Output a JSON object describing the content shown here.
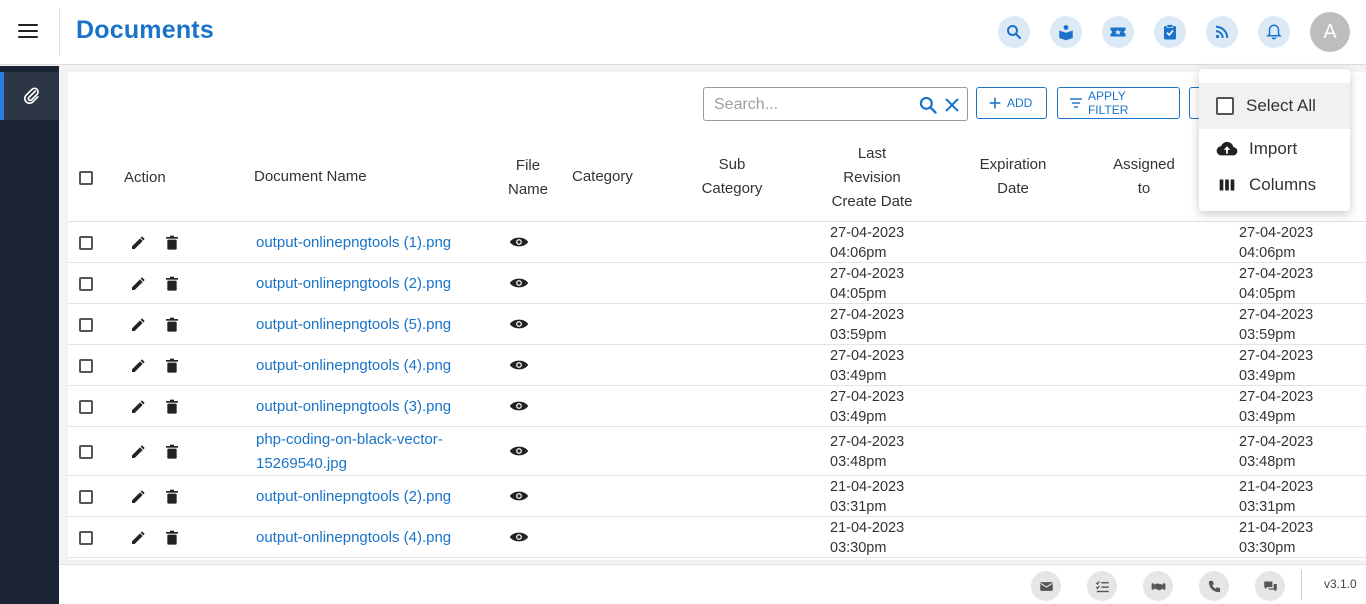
{
  "header": {
    "title": "Documents",
    "icons": [
      "search-icon",
      "book-reader-icon",
      "ticket-icon",
      "clipboard-check-icon",
      "rss-icon",
      "bell-icon"
    ],
    "avatar_letter": "A"
  },
  "sidebar": {
    "items": [
      {
        "icon": "paperclip-icon"
      }
    ]
  },
  "toolbar": {
    "search_placeholder": "Search...",
    "add_label": "ADD",
    "filter_label": "APPLY FILTER"
  },
  "table": {
    "headers": {
      "action": "Action",
      "document_name": "Document Name",
      "file_name_1": "File",
      "file_name_2": "Name",
      "category": "Category",
      "sub_category_1": "Sub",
      "sub_category_2": "Category",
      "last_revision_1": "Last",
      "last_revision_2": "Revision",
      "last_revision_3": "Create Date",
      "expiration_1": "Expiration",
      "expiration_2": "Date",
      "assigned_1": "Assigned",
      "assigned_2": "to"
    },
    "rows": [
      {
        "name": "output-onlinepngtools (1).png",
        "rev_date": "27-04-2023",
        "rev_time": "04:06pm",
        "c_date": "27-04-2023",
        "c_time": "04:06pm"
      },
      {
        "name": "output-onlinepngtools (2).png",
        "rev_date": "27-04-2023",
        "rev_time": "04:05pm",
        "c_date": "27-04-2023",
        "c_time": "04:05pm"
      },
      {
        "name": "output-onlinepngtools (5).png",
        "rev_date": "27-04-2023",
        "rev_time": "03:59pm",
        "c_date": "27-04-2023",
        "c_time": "03:59pm"
      },
      {
        "name": "output-onlinepngtools (4).png",
        "rev_date": "27-04-2023",
        "rev_time": "03:49pm",
        "c_date": "27-04-2023",
        "c_time": "03:49pm"
      },
      {
        "name": "output-onlinepngtools (3).png",
        "rev_date": "27-04-2023",
        "rev_time": "03:49pm",
        "c_date": "27-04-2023",
        "c_time": "03:49pm"
      },
      {
        "name_line1": "php-coding-on-black-vector-",
        "name_line2": "15269540.jpg",
        "rev_date": "27-04-2023",
        "rev_time": "03:48pm",
        "c_date": "27-04-2023",
        "c_time": "03:48pm"
      },
      {
        "name": "output-onlinepngtools (2).png",
        "rev_date": "21-04-2023",
        "rev_time": "03:31pm",
        "c_date": "21-04-2023",
        "c_time": "03:31pm"
      },
      {
        "name": "output-onlinepngtools (4).png",
        "rev_date": "21-04-2023",
        "rev_time": "03:30pm",
        "c_date": "21-04-2023",
        "c_time": "03:30pm"
      }
    ]
  },
  "menu": {
    "select_all": "Select All",
    "import": "Import",
    "columns": "Columns"
  },
  "footer": {
    "icons": [
      "mail-icon",
      "checklist-icon",
      "handshake-icon",
      "phone-icon",
      "chat-icon"
    ],
    "version": "v3.1.0"
  },
  "colors": {
    "brand": "#1a73c8",
    "sidebar": "#1b2434",
    "icon_bg": "#dce9f7"
  }
}
